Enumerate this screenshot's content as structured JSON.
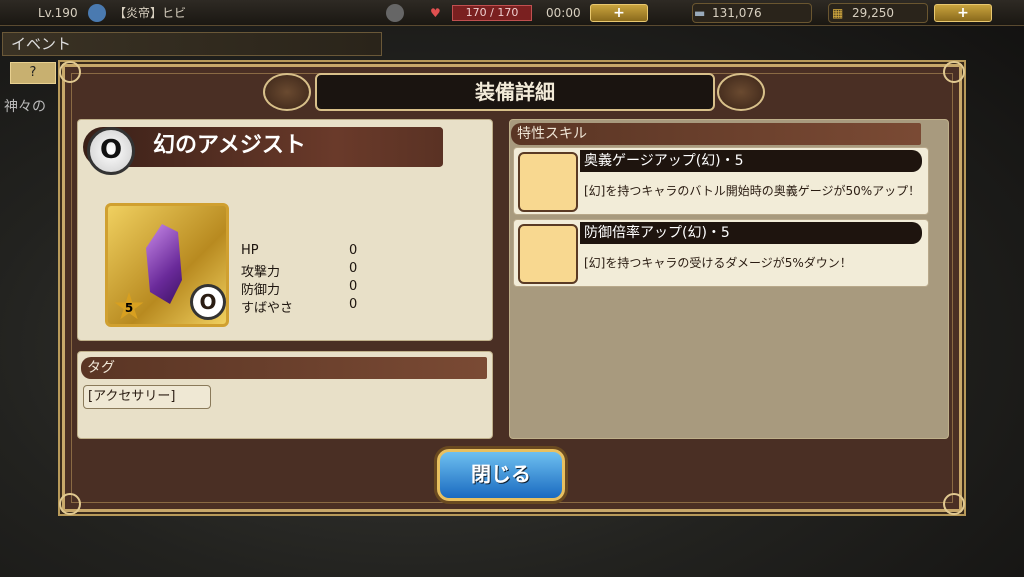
{
  "statusbar": {
    "level": "Lv.190",
    "player_name": "【炎帝】ヒビ",
    "stamina": "170 / 170",
    "timer": "00:00",
    "plus": "+",
    "gems": "131,076",
    "gold": "29,250"
  },
  "event": {
    "label": "イベント",
    "question": "?",
    "sub": "神々の"
  },
  "modal": {
    "title": "装備詳細",
    "item_name": "幻のアメジスト",
    "rarity": "5",
    "ring_symbol": "O",
    "stats": [
      {
        "label": "HP",
        "value": "0"
      },
      {
        "label": "攻撃力",
        "value": "0"
      },
      {
        "label": "防御力",
        "value": "0"
      },
      {
        "label": "すばやさ",
        "value": "0"
      }
    ],
    "tag_header": "タグ",
    "tag": "[アクセサリー]",
    "skill_header": "特性スキル",
    "skills": [
      {
        "name": "奥義ゲージアップ(幻)・5",
        "desc": "[幻]を持つキャラのバトル開始時の奥義ゲージが50%アップ！"
      },
      {
        "name": "防御倍率アップ(幻)・5",
        "desc": "[幻]を持つキャラの受けるダメージが5%ダウン！"
      }
    ],
    "close_label": "閉じる"
  }
}
